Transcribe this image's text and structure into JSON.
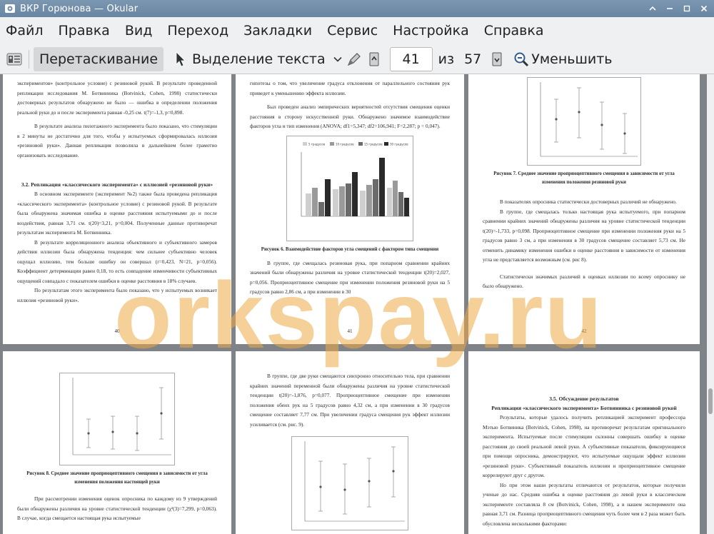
{
  "window": {
    "title": "ВКР Горюнова  — Okular",
    "controls": [
      "minimize",
      "maximize",
      "close"
    ]
  },
  "menu": {
    "items": [
      "Файл",
      "Правка",
      "Вид",
      "Переход",
      "Закладки",
      "Сервис",
      "Настройка",
      "Справка"
    ]
  },
  "toolbar": {
    "browse_label": "Перетаскивание",
    "text_select_label": "Выделение текста",
    "current_page": "41",
    "of_label": "из",
    "total_pages": "57",
    "zoom_out_label": "Уменьшить"
  },
  "watermark": "orkspay.ru",
  "pages": {
    "p40": {
      "para1": "экспериментов» (контрольное условие) с резиновой рукой. В результате проведенной репликации исследования М. Ботвинника (Botvinick, Cohen, 1998) статистически достоверных результатов обнаружено не было — ошибка в определении положения реальной руки до и после эксперимента равная -0,25 см. t(7)=-1,3, p=0,898.",
      "para2": "В результате анализа пилотажного эксперимента было показано, что стимуляции в 2 минуты не достаточно для того, чтобы у испытуемых сформировалась иллюзия «резиновой руки». Данная репликация позволила в дальнейшем более грамотно организовать исследование.",
      "heading": "3.2. Репликация «классического эксперимента» с иллюзией «резиновой руки»",
      "para3": "В основном эксперименте (эксперимент №2) также была проведена репликация «классического эксперимента» (контрольное условие) с резиновой рукой. В результате была обнаружена значимая ошибка в оценке расстояния испытуемыми до и после воздействия, равная 3,71 см. t(20)=3,21, p=0,004. Полученные данные противоречат результатам эксперимента М. Ботвинника.",
      "para4": "В результате корреляционного анализа объективного и субъективного замеров действия иллюзии была обнаружена тенденция: чем сильнее субъективно человек ощущал иллюзию, тем больше ошибку он совершал (r=0,423, N=21, p=0,056). Коэффициент детерминации равен 0,18, то есть совпадение изменчивости субъективных ощущений совпадало с показателем ошибки в оценке расстояния в 18% случаев.",
      "para5": "По результатам этого эксперимента было показано, что у испытуемых возникает иллюзия «резиновой руки».",
      "number": "40"
    },
    "p41": {
      "para1": "гипотезы о том, что увеличение градуса отклонения от параллельного состояния рук приведет к уменьшению эффекта иллюзии.",
      "para2": "Был проведен анализ эмпирических вероятностей отсутствия смещения оценки расстояния в сторону искусственной руки. Обнаружено значимое взаимодействие факторов угла и тип изменения (ANOVA; df1=5,347; df2=106,941; F=2,287; p = 0,047).",
      "caption": "Рисунок 6. Взаимодействие факторов угла смещений с фактором типа смещения",
      "para3": "В группе, где смещалась резиновая рука, при попарном сравнении крайних значений были обнаружены различия на уровне статистической тенденции t(20)=2,027, p=0,056. Проприоцептивное смещение при изменении положения резиновой руки на 5 градусов равно 2,86 см, а при изменении в 30",
      "number": "41"
    },
    "p42": {
      "caption": "Рисунок 7. Среднее значение проприоцептивного смещения в зависимости от угла изменения положения резиновой руки",
      "para1": "В показателях опросника статистически достоверных различий не обнаружено.",
      "para2": "В группе, где смещалась только настоящая рука испытуемого, при попарном сравнении крайних значений обнаружены различия на уровне статистической тенденции t(20)=-1,733, p=0,098. Проприоцептивное смещение при изменении положения руки на 5 градусов равно 3 см, а при изменении в 30 градусов смещение составляет 5,73 см. Не отменить динамику изменения ошибки в оценке расстояния в зависимости от изменения угла не представляется возможным (см. рис 8).",
      "para3": "Статистически значимых различий в оценках иллюзии по всему опроснику не было обнаружено.",
      "number": "42"
    },
    "p43": {
      "caption": "Рисунок 8. Среднее значение проприоцептивного смещения в зависимости от угла изменения положения настоящей руки",
      "para1": "При рассмотрении изменения оценок опросника по каждому из 9 утверждений были обнаружены различия на уровне статистической тенденции (χ²(3)=7,299, p=0,063). В случае, когда смещается настоящая рука испытуемые"
    },
    "p44": {
      "para1": "В группе, где две руки смещаются синхронно относительно тела, при сравнении крайних значений переменной были обнаружены различия на уровне статистической тенденции t(20)=-1,876, p=0,077. Проприоцептивное смещение при изменении положения обеих рук на 5 градусов равно 4,32 см, а при изменении в 30 градусов смещение составляет 7,77 см. При увеличении градуса смещения рук эффект иллюзии усиливается (см. рис. 9)."
    },
    "p45": {
      "heading1": "3.5. Обсуждение результатов",
      "heading2": "Репликация «классического эксперимента» Ботвинника с резиновой рукой",
      "para1": "Результаты, которые удалось получить репликацией эксперимент профессора Мэтью Ботвиника (Botvinick, Cohen, 1998), на противоречат результатам оригинального эксперимента. Испытуемые после стимуляции склонны совершать ошибку в оценке расстояния до своей реальной левой руки. А субъективные показатели, фиксирующиеся при помощи опросника, демонстрируют, что испытуемые ощущали эффект иллюзии «резиновой руки». Субъективный показатель иллюзии и проприоцептивное смещение коррелируют друг с другом.",
      "para2": "Но при этом наши результаты отличаются от результатов, которые получили ученые до нас. Средняя ошибка в оценке расстояния до левой руки в классическом эксперименте составляла 8 см (Botvinick, Cohen, 1998), а в нашем эксперименте она равная 3,71 см. Разница проприоцептивного смещения чуть более чем в 2 раза может быть обусловлена несколькими факторами:"
    }
  },
  "chart_legend": [
    "5 градусов",
    "10 градусов",
    "15 градусов",
    "30 градусов"
  ],
  "colors": {
    "titlebar": "#6f8cab",
    "chrome": "#eff0f1",
    "viewport": "#7f8388",
    "watermark": "#ecaa46"
  }
}
